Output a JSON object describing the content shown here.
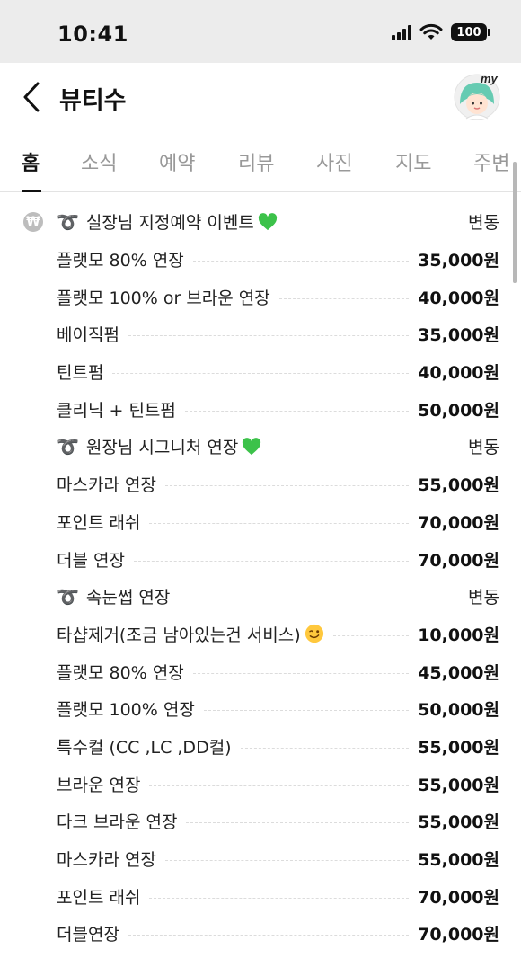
{
  "status_bar": {
    "time": "10:41",
    "battery": "100"
  },
  "header": {
    "title": "뷰티수",
    "avatar_badge": "my"
  },
  "tabs": [
    "홈",
    "소식",
    "예약",
    "리뷰",
    "사진",
    "지도",
    "주변"
  ],
  "price_list": {
    "currency_icon": "₩",
    "rows": [
      {
        "name": "실장님 지정예약 이벤트",
        "price": "변동",
        "ribbon": "➰",
        "emoji": "green-heart"
      },
      {
        "name": "플랫모 80% 연장",
        "price": "35,000원"
      },
      {
        "name": "플랫모 100% or 브라운 연장",
        "price": "40,000원"
      },
      {
        "name": "베이직펌",
        "price": "35,000원"
      },
      {
        "name": "틴트펌",
        "price": "40,000원"
      },
      {
        "name": "클리닉 + 틴트펌",
        "price": "50,000원"
      },
      {
        "name": "원장님 시그니처 연장",
        "price": "변동",
        "ribbon": "➰",
        "emoji": "green-heart"
      },
      {
        "name": "마스카라 연장",
        "price": "55,000원"
      },
      {
        "name": "포인트 래쉬",
        "price": "70,000원"
      },
      {
        "name": "더블 연장",
        "price": "70,000원"
      },
      {
        "name": "속눈썹 연장",
        "price": "변동",
        "ribbon": "➰"
      },
      {
        "name": "타샵제거(조금 남아있는건 서비스)",
        "price": "10,000원",
        "emoji": "wink"
      },
      {
        "name": "플랫모 80% 연장",
        "price": "45,000원"
      },
      {
        "name": "플랫모 100% 연장",
        "price": "50,000원"
      },
      {
        "name": "특수컬 (CC ,LC ,DD컬)",
        "price": "55,000원"
      },
      {
        "name": "브라운 연장",
        "price": "55,000원"
      },
      {
        "name": "다크 브라운 연장",
        "price": "55,000원"
      },
      {
        "name": "마스카라 연장",
        "price": "55,000원"
      },
      {
        "name": "포인트 래쉬",
        "price": "70,000원"
      },
      {
        "name": "더블연장",
        "price": "70,000원"
      }
    ]
  },
  "colors": {
    "accent": "#111111",
    "muted": "#999999",
    "heart": "#3cc24a",
    "status_bg": "#ececec"
  }
}
